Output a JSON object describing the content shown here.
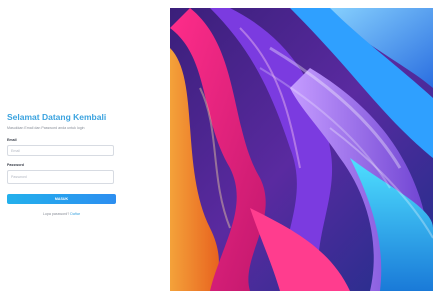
{
  "login": {
    "title": "Selamat Datang Kembali",
    "subtitle": "Masukkan Email dan Password anda untuk login",
    "email_label": "Email",
    "email_placeholder": "Email",
    "password_label": "Password",
    "password_placeholder": "Password",
    "submit_label": "MASUK",
    "forgot_prefix": "Lupa password?",
    "forgot_link": "Daftar"
  },
  "colors": {
    "accent": "#3ba3df",
    "button_start": "#23b0ec",
    "button_end": "#2c8ef0"
  }
}
